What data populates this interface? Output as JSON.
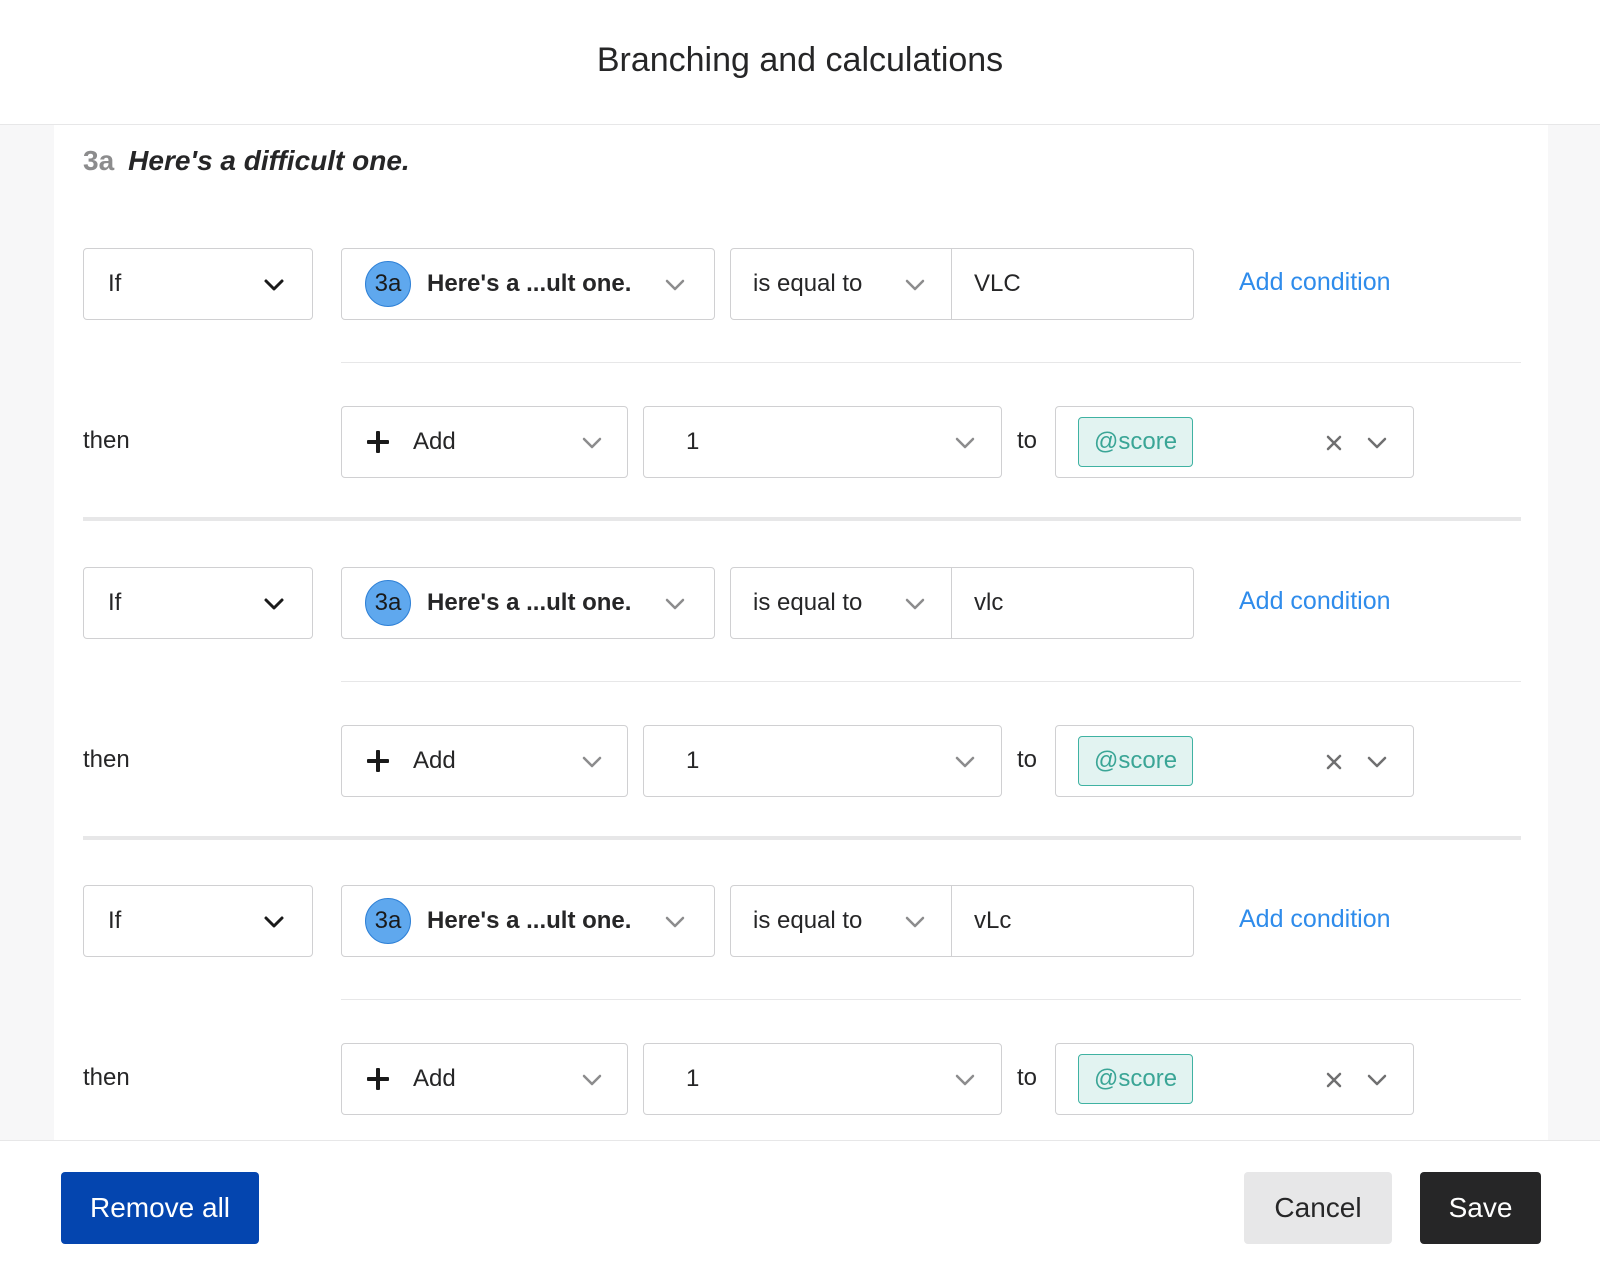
{
  "modal": {
    "title": "Branching and calculations"
  },
  "question": {
    "ref": "3a",
    "text": "Here's a difficult one."
  },
  "rules": [
    {
      "if_label": "If",
      "question_badge": "3a",
      "question_label": "Here's a ...ult one.",
      "operator": "is equal to",
      "value": "VLC",
      "add_condition_label": "Add condition",
      "then_label": "then",
      "action": "Add",
      "amount": "1",
      "to_label": "to",
      "variable": "@score"
    },
    {
      "if_label": "If",
      "question_badge": "3a",
      "question_label": "Here's a ...ult one.",
      "operator": "is equal to",
      "value": "vlc",
      "add_condition_label": "Add condition",
      "then_label": "then",
      "action": "Add",
      "amount": "1",
      "to_label": "to",
      "variable": "@score"
    },
    {
      "if_label": "If",
      "question_badge": "3a",
      "question_label": "Here's a ...ult one.",
      "operator": "is equal to",
      "value": "vLc",
      "add_condition_label": "Add condition",
      "then_label": "then",
      "action": "Add",
      "amount": "1",
      "to_label": "to",
      "variable": "@score"
    }
  ],
  "footer": {
    "remove_all_label": "Remove all",
    "cancel_label": "Cancel",
    "save_label": "Save"
  },
  "icons": {
    "dropdown": "chevron-down-icon",
    "add": "plus-icon",
    "clear": "close-icon"
  },
  "colors": {
    "primary_button": "#0445af",
    "save_button": "#262627",
    "link": "#2f8ceb",
    "question_badge": "#5fa8ee",
    "variable_chip_bg": "#e2f3f1",
    "variable_chip_text": "#3aa596"
  }
}
